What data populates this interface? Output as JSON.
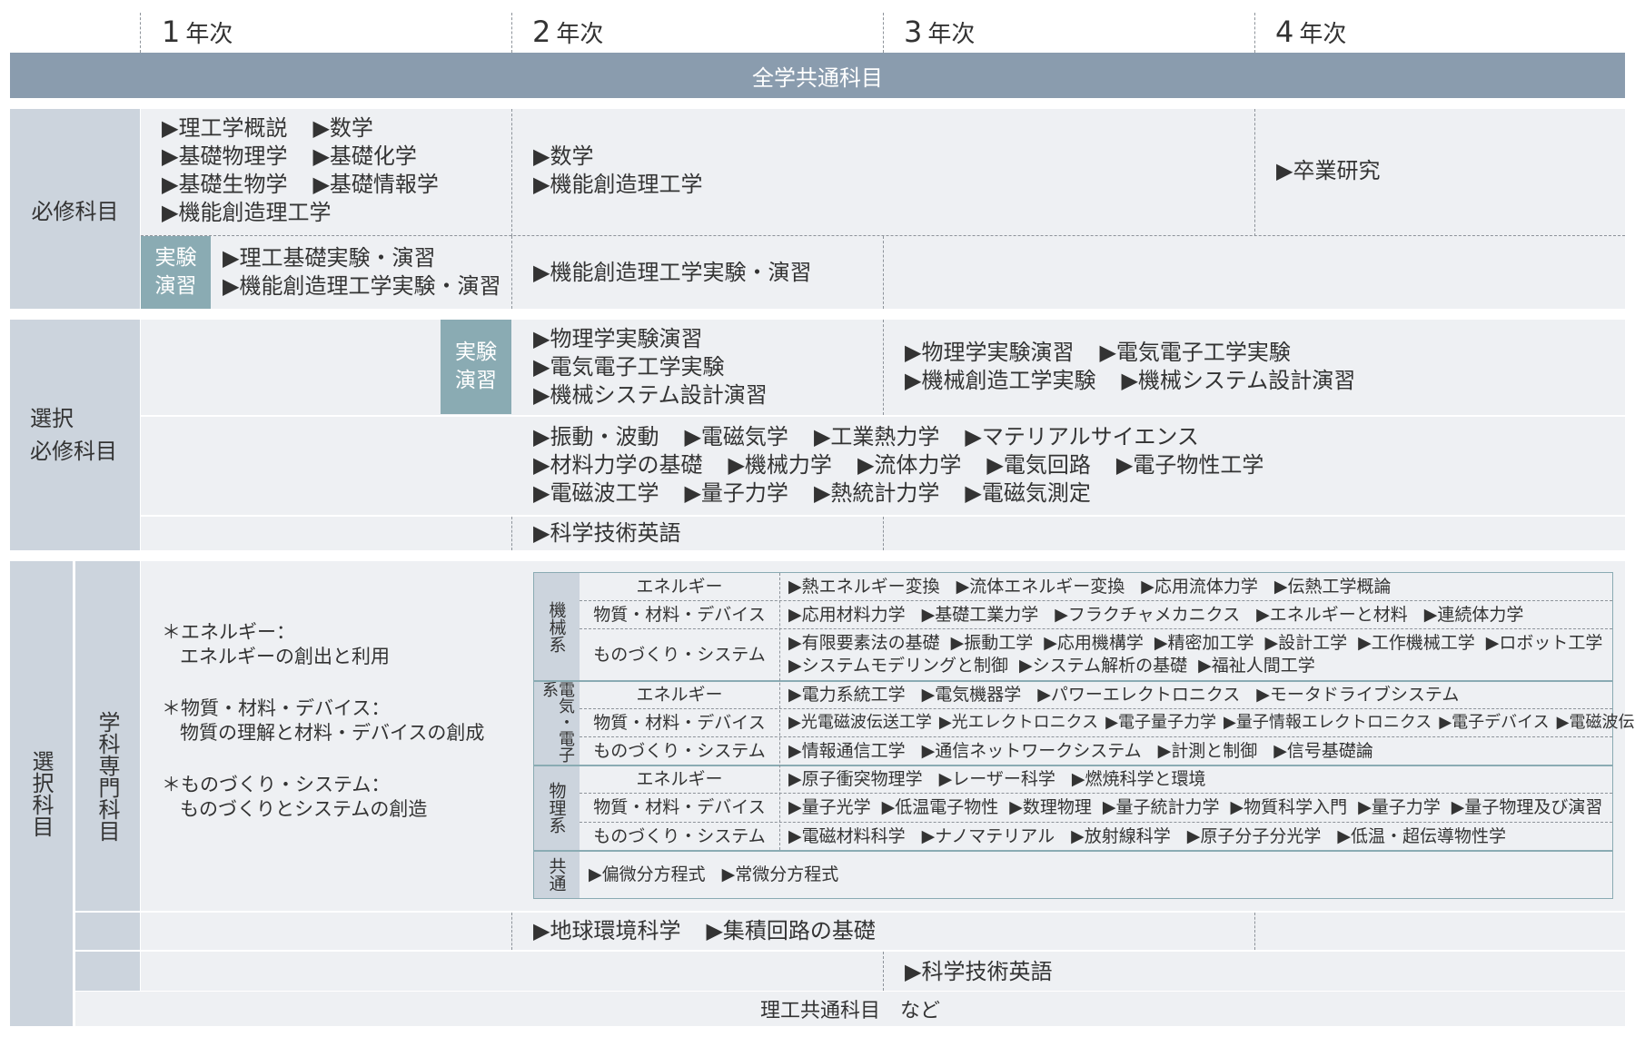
{
  "years": [
    {
      "num": "1",
      "label": "年次"
    },
    {
      "num": "2",
      "label": "年次"
    },
    {
      "num": "3",
      "label": "年次"
    },
    {
      "num": "4",
      "label": "年次"
    }
  ],
  "common_bar": "全学共通科目",
  "labels": {
    "required": "必修科目",
    "selective_required": [
      "選択",
      "必修科目"
    ],
    "elective": "選択科目",
    "dept_specialty": "学科専門科目",
    "lab_badge": [
      "実験",
      "演習"
    ],
    "bottom": "理工共通科目　など"
  },
  "required": {
    "y1": [
      "▶理工学概説",
      "▶数学",
      "▶基礎物理学",
      "▶基礎化学",
      "▶基礎生物学",
      "▶基礎情報学",
      "▶機能創造理工学"
    ],
    "y2_3": [
      "▶数学",
      "▶機能創造理工学"
    ],
    "y4": [
      "▶卒業研究"
    ],
    "lab_y1": [
      "▶理工基礎実験・演習",
      "▶機能創造理工学実験・演習"
    ],
    "lab_y2": [
      "▶機能創造理工学実験・演習"
    ]
  },
  "selective_required": {
    "lab_y2": [
      "▶物理学実験演習",
      "▶電気電子工学実験",
      "▶機械システム設計演習"
    ],
    "lab_y3": [
      "▶物理学実験演習",
      "▶電気電子工学実験",
      "▶機械創造工学実験",
      "▶機械システム設計演習"
    ],
    "lectures": [
      [
        "▶振動・波動",
        "▶電磁気学",
        "▶工業熱力学",
        "▶マテリアルサイエンス"
      ],
      [
        "▶材料力学の基礎",
        "▶機械力学",
        "▶流体力学",
        "▶電気回路",
        "▶電子物性工学"
      ],
      [
        "▶電磁波工学",
        "▶量子力学",
        "▶熱統計力学",
        "▶電磁気測定"
      ]
    ],
    "english": "▶科学技術英語"
  },
  "footnotes": [
    {
      "title": "＊エネルギー：",
      "desc": "エネルギーの創出と利用"
    },
    {
      "title": "＊物質・材料・デバイス：",
      "desc": "物質の理解と材料・デバイスの創成"
    },
    {
      "title": "＊ものづくり・システム：",
      "desc": "ものづくりとシステムの創造"
    }
  ],
  "tracks": {
    "energy": "エネルギー",
    "materials": "物質・材料・デバイス",
    "manufacturing": "ものづくり・システム"
  },
  "groups": [
    {
      "name": "機械系",
      "rows": [
        {
          "track": "エネルギー",
          "lines": [
            [
              "▶熱エネルギー変換",
              "▶流体エネルギー変換",
              "▶応用流体力学",
              "▶伝熱工学概論"
            ]
          ]
        },
        {
          "track": "物質・材料・デバイス",
          "lines": [
            [
              "▶応用材料力学",
              "▶基礎工業力学",
              "▶フラクチャメカニクス",
              "▶エネルギーと材料",
              "▶連続体力学"
            ]
          ]
        },
        {
          "track": "ものづくり・システム",
          "lines": [
            [
              "▶有限要素法の基礎",
              "▶振動工学",
              "▶応用機構学",
              "▶精密加工学",
              "▶設計工学",
              "▶工作機械工学",
              "▶ロボット工学"
            ],
            [
              "▶システムモデリングと制御",
              "▶システム解析の基礎",
              "▶福祉人間工学"
            ]
          ]
        }
      ]
    },
    {
      "name": "電気・電子系",
      "rows": [
        {
          "track": "エネルギー",
          "lines": [
            [
              "▶電力系統工学",
              "▶電気機器学",
              "▶パワーエレクトロニクス",
              "▶モータドライブシステム"
            ]
          ]
        },
        {
          "track": "物質・材料・デバイス",
          "lines": [
            [
              "▶光電磁波伝送工学",
              "▶光エレクトロニクス",
              "▶電子量子力学",
              "▶量子情報エレクトロニクス",
              "▶電子デバイス",
              "▶電磁波伝搬の基礎"
            ]
          ]
        },
        {
          "track": "ものづくり・システム",
          "lines": [
            [
              "▶情報通信工学",
              "▶通信ネットワークシステム",
              "▶計測と制御",
              "▶信号基礎論"
            ]
          ]
        }
      ]
    },
    {
      "name": "物理系",
      "rows": [
        {
          "track": "エネルギー",
          "lines": [
            [
              "▶原子衝突物理学",
              "▶レーザー科学",
              "▶燃焼科学と環境"
            ]
          ]
        },
        {
          "track": "物質・材料・デバイス",
          "lines": [
            [
              "▶量子光学",
              "▶低温電子物性",
              "▶数理物理",
              "▶量子統計力学",
              "▶物質科学入門",
              "▶量子力学",
              "▶量子物理及び演習"
            ]
          ]
        },
        {
          "track": "ものづくり・システム",
          "lines": [
            [
              "▶電磁材料科学",
              "▶ナノマテリアル",
              "▶放射線科学",
              "▶原子分子分光学",
              "▶低温・超伝導物性学"
            ]
          ]
        }
      ]
    },
    {
      "name": "共通",
      "lines": [
        [
          "▶偏微分方程式",
          "▶常微分方程式"
        ]
      ]
    }
  ],
  "elective_more": {
    "y2_3": [
      "▶地球環境科学",
      "▶集積回路の基礎"
    ],
    "english": "▶科学技術英語"
  }
}
